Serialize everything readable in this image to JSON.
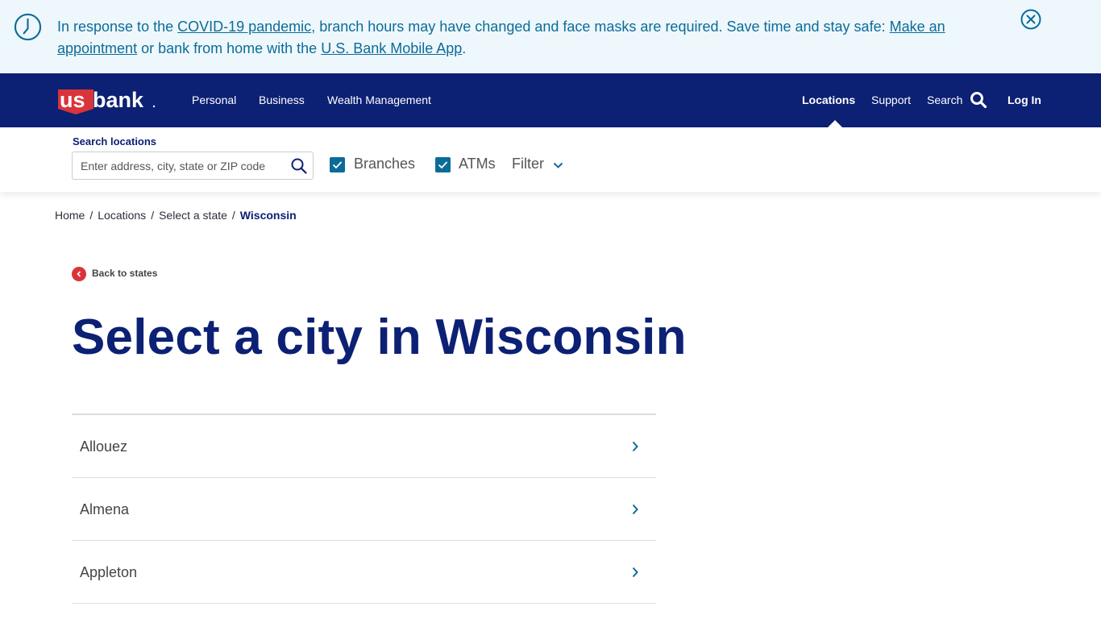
{
  "banner": {
    "text_1": "In response to the ",
    "link_covid": "COVID-19 pandemic",
    "text_2": ", branch hours may have changed and face masks are required. Save time and stay safe: ",
    "link_appointment": "Make an appointment",
    "text_3": " or bank from home with the ",
    "link_app": "U.S. Bank Mobile App",
    "text_4": ".",
    "icon": "clock-icon",
    "close_icon": "close-circle-icon"
  },
  "nav": {
    "logo_text_us": "us",
    "logo_text_bank": "bank",
    "items_left": [
      "Personal",
      "Business",
      "Wealth Management"
    ],
    "locations": "Locations",
    "support": "Support",
    "search": "Search",
    "login": "Log In",
    "active": "Locations"
  },
  "search": {
    "label": "Search locations",
    "placeholder": "Enter address, city, state or ZIP code",
    "value": "",
    "branches_label": "Branches",
    "branches_checked": true,
    "atms_label": "ATMs",
    "atms_checked": true,
    "filter_label": "Filter"
  },
  "breadcrumb": {
    "items": [
      "Home",
      "Locations",
      "Select a state"
    ],
    "current": "Wisconsin",
    "separator": "/"
  },
  "back_link": "Back to states",
  "title": "Select a city in Wisconsin",
  "cities": [
    "Allouez",
    "Almena",
    "Appleton"
  ],
  "colors": {
    "brand_navy": "#0c2074",
    "brand_red": "#d9343a",
    "link_blue": "#0c6c99",
    "banner_bg": "#eef7fb"
  }
}
